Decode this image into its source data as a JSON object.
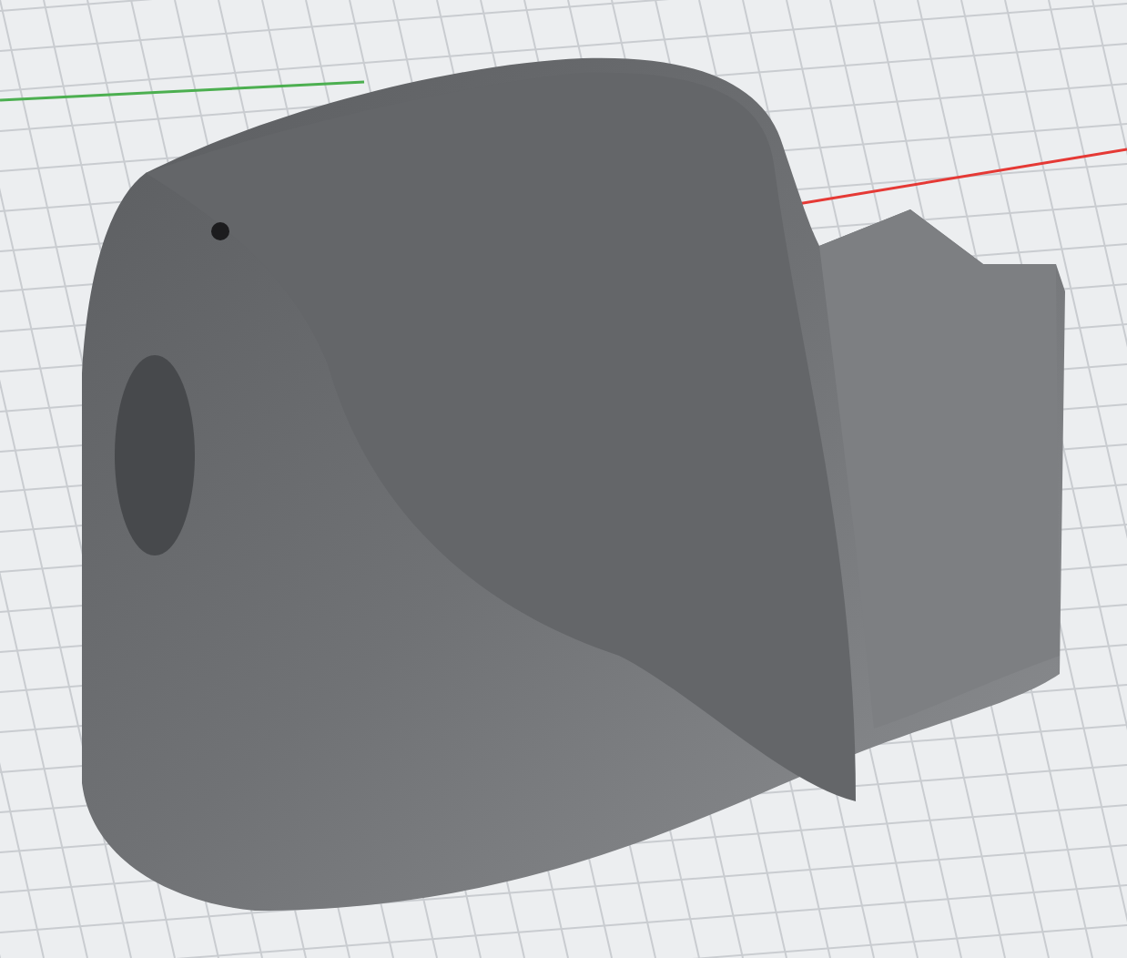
{
  "viewport": {
    "grid": true,
    "axes": [
      {
        "kind": "y",
        "color": "#4caf50"
      },
      {
        "kind": "x",
        "color": "#e53935"
      }
    ],
    "model": {
      "kind": "shell"
    }
  }
}
